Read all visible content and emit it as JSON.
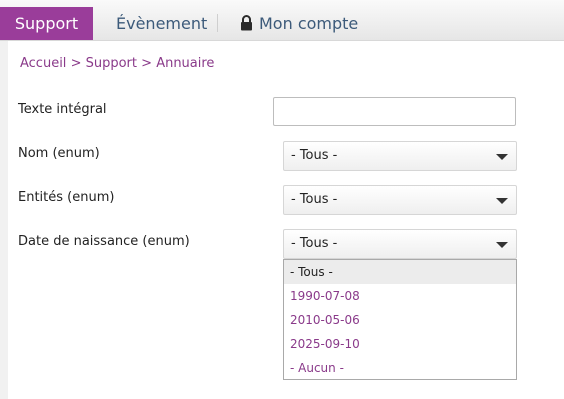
{
  "nav": {
    "tabs": [
      {
        "label": "Support"
      },
      {
        "label": "Évènement"
      },
      {
        "label": "Mon compte"
      }
    ]
  },
  "breadcrumb": {
    "items": [
      "Accueil",
      "Support",
      "Annuaire"
    ],
    "separator": ">"
  },
  "form": {
    "full_text": {
      "label": "Texte intégral",
      "value": ""
    },
    "nom": {
      "label": "Nom (enum)",
      "value": "- Tous -"
    },
    "entites": {
      "label": "Entités (enum)",
      "value": "- Tous -"
    },
    "date": {
      "label": "Date de naissance (enum)",
      "value": "- Tous -",
      "options": [
        "- Tous -",
        "1990-07-08",
        "2010-05-06",
        "2025-09-10",
        "- Aucun -"
      ]
    }
  },
  "colors": {
    "accent": "#9a3d9a",
    "link": "#8a3a8a",
    "nav_text": "#3c5a7a"
  },
  "icons": {
    "account": "lock-icon",
    "dropdown": "chevron-down-icon"
  }
}
